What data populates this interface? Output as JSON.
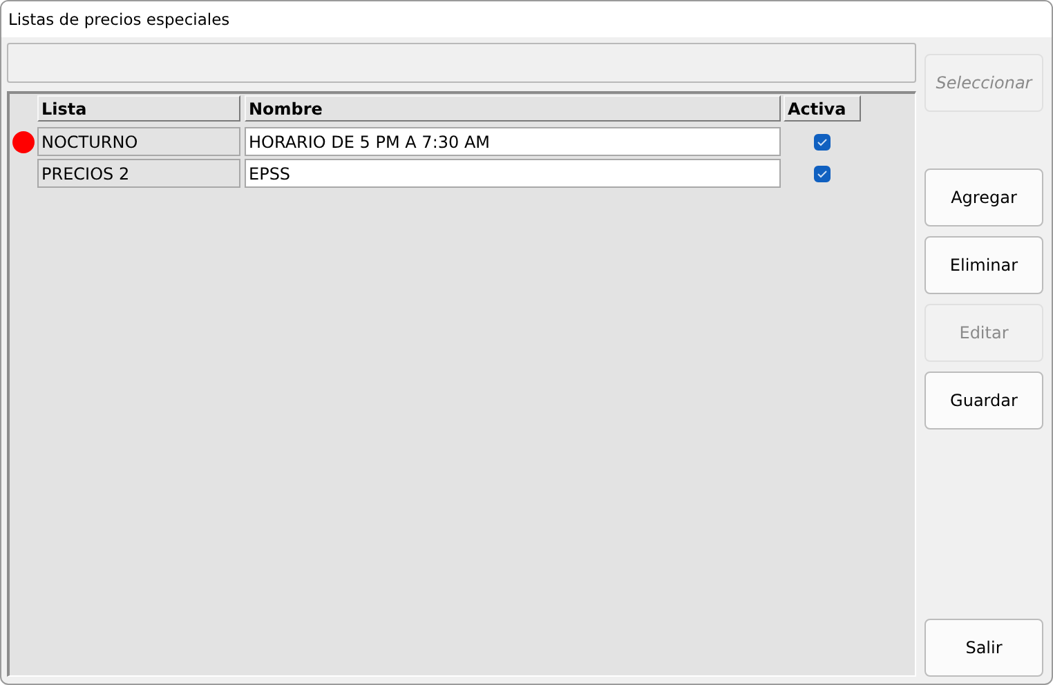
{
  "window": {
    "title": "Listas de precios especiales"
  },
  "table": {
    "columns": [
      "Lista",
      "Nombre",
      "Activa"
    ],
    "rows": [
      {
        "lista": "NOCTURNO",
        "nombre": "HORARIO DE 5 PM A 7:30 AM",
        "activa": true,
        "selected": true
      },
      {
        "lista": "PRECIOS 2",
        "nombre": "EPSS",
        "activa": true,
        "selected": false
      }
    ]
  },
  "select_button": {
    "label": "Seleccionar",
    "disabled": true
  },
  "buttons": [
    {
      "label": "Agregar",
      "disabled": false
    },
    {
      "label": "Eliminar",
      "disabled": false
    },
    {
      "label": "Editar",
      "disabled": true
    },
    {
      "label": "Guardar",
      "disabled": false
    }
  ],
  "exit_button": {
    "label": "Salir",
    "disabled": false
  }
}
